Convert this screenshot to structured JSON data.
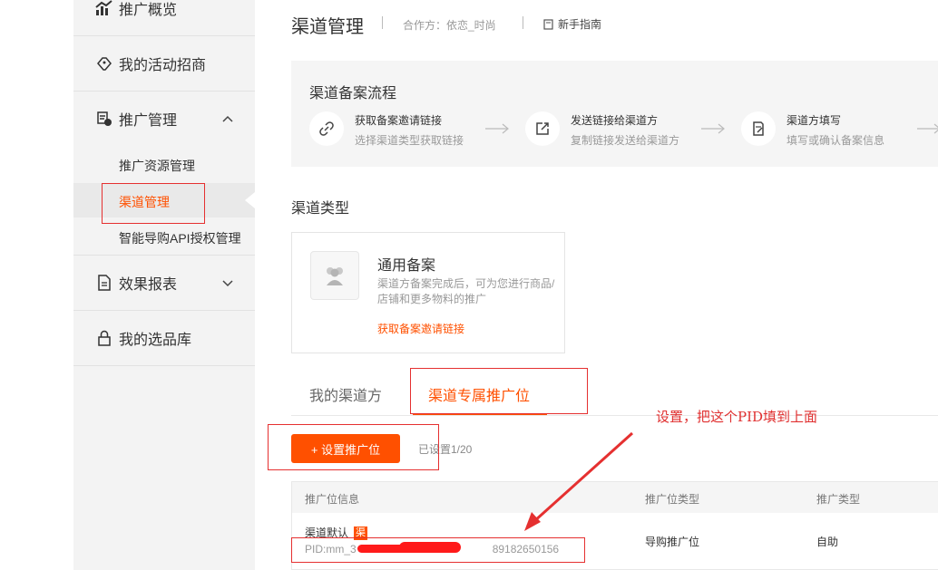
{
  "sidebar": {
    "items": [
      {
        "label": "推广概览",
        "icon": "chart-icon"
      },
      {
        "label": "我的活动招商",
        "icon": "handshake-icon"
      },
      {
        "label": "推广管理",
        "icon": "coin-icon",
        "expanded": true
      },
      {
        "label": "效果报表",
        "icon": "document-icon",
        "expanded": false
      },
      {
        "label": "我的选品库",
        "icon": "lock-icon"
      }
    ],
    "sub_items": [
      {
        "label": "推广资源管理",
        "active": false
      },
      {
        "label": "渠道管理",
        "active": true
      },
      {
        "label": "智能导购API授权管理",
        "active": false
      }
    ]
  },
  "header": {
    "title": "渠道管理",
    "partner": "合作方：依恋_时尚",
    "guide": "新手指南"
  },
  "flow": {
    "title": "渠道备案流程",
    "steps": [
      {
        "title": "获取备案邀请链接",
        "desc": "选择渠道类型获取链接",
        "icon": "link-icon"
      },
      {
        "title": "发送链接给渠道方",
        "desc": "复制链接发送给渠道方",
        "icon": "share-icon"
      },
      {
        "title": "渠道方填写",
        "desc": "填写或确认备案信息",
        "icon": "edit-doc-icon"
      }
    ]
  },
  "channel_type": {
    "label": "渠道类型",
    "card": {
      "title": "通用备案",
      "desc": "渠道方备案完成后，可为您进行商品/店铺和更多物料的推广",
      "link": "获取备案邀请链接",
      "icon": "users-icon"
    }
  },
  "tabs": [
    {
      "label": "我的渠道方",
      "active": false
    },
    {
      "label": "渠道专属推广位",
      "active": true
    }
  ],
  "toolbar": {
    "add_label": "+ 设置推广位",
    "count": "已设置1/20"
  },
  "table": {
    "headers": [
      "推广位信息",
      "推广位类型",
      "推广类型"
    ],
    "rows": [
      {
        "name": "渠道默认",
        "tag": "渠",
        "pid_prefix": "PID:mm_3",
        "pid_suffix": "89182650156",
        "type": "导购推广位",
        "promo_type": "自助"
      }
    ]
  },
  "annotation": {
    "text": "设置，把这个PID填到上面",
    "color": "#e03030"
  },
  "colors": {
    "accent": "#ff5000",
    "annotation": "#e53030"
  }
}
